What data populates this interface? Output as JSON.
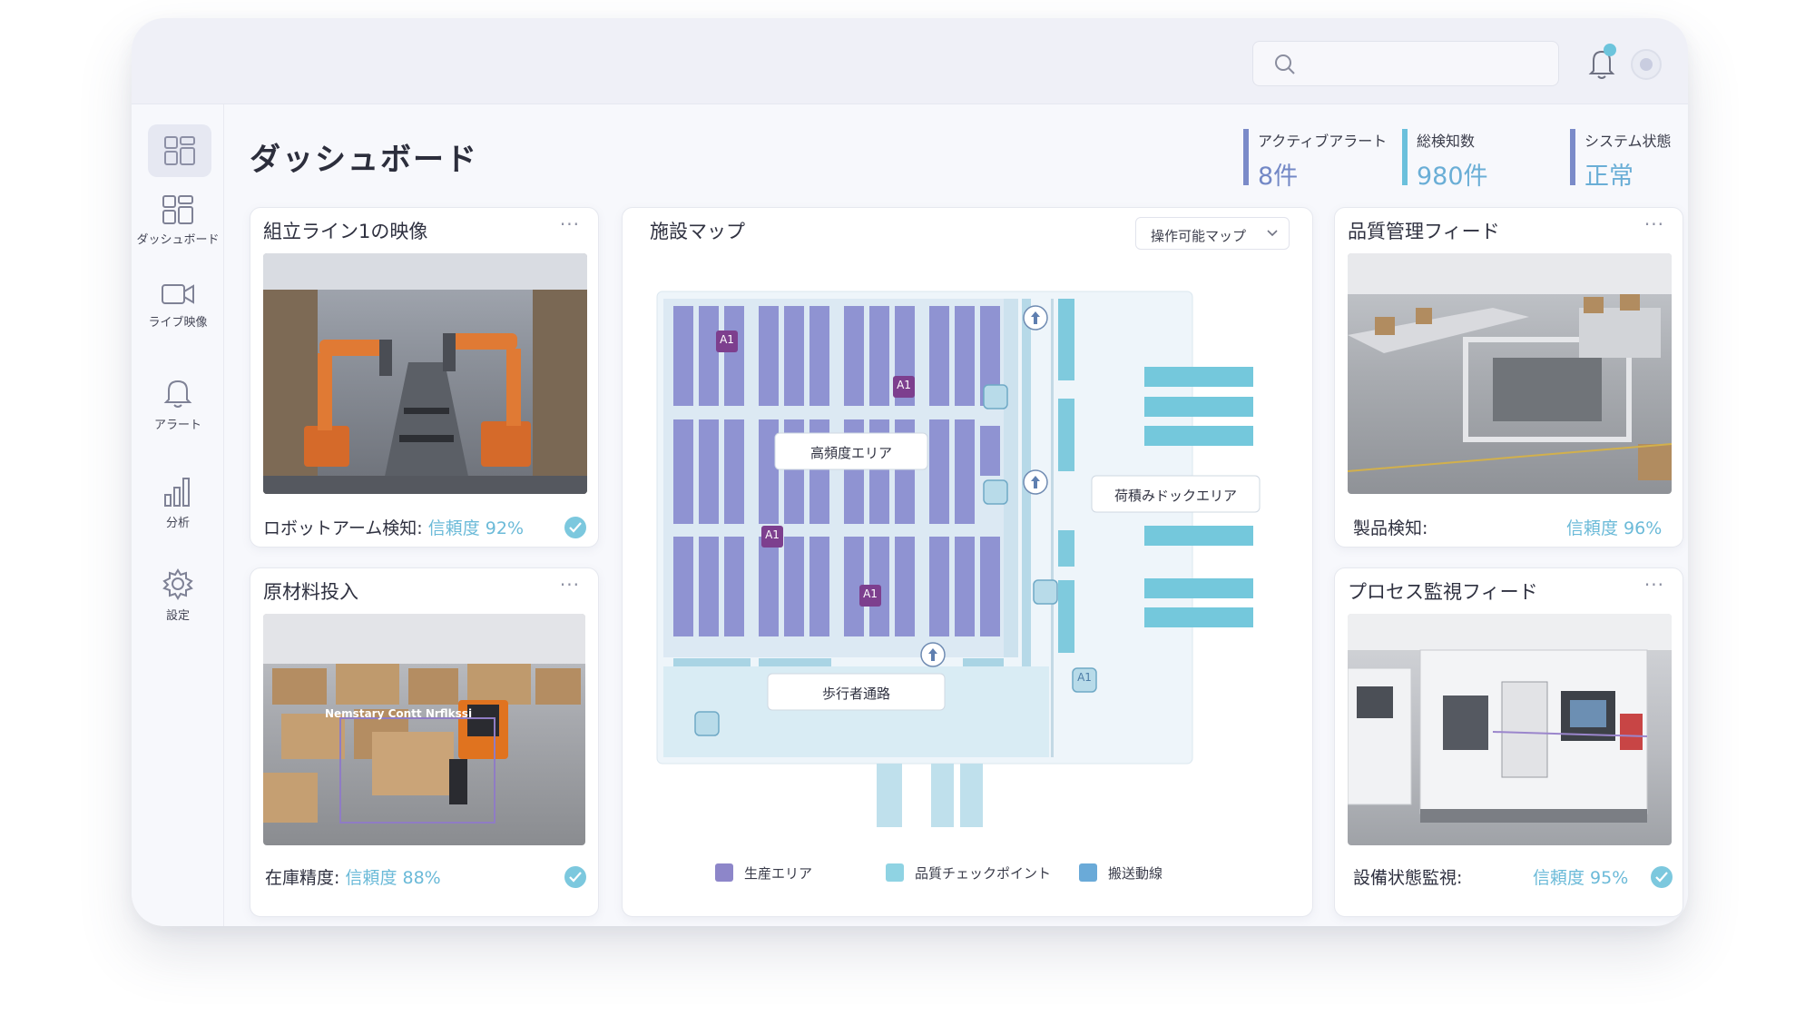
{
  "header": {
    "search_placeholder": ""
  },
  "sidebar": {
    "items": [
      {
        "label": "ダッシュボード",
        "icon": "dashboard-icon"
      },
      {
        "label": "ライブ映像",
        "icon": "video-camera-icon"
      },
      {
        "label": "アラート",
        "icon": "bell-icon"
      },
      {
        "label": "分析",
        "icon": "bar-chart-icon"
      },
      {
        "label": "設定",
        "icon": "gear-icon"
      }
    ]
  },
  "page": {
    "title": "ダッシュボード"
  },
  "stats": [
    {
      "label": "アクティブアラート",
      "value": "8件"
    },
    {
      "label": "総検知数",
      "value": "980件"
    },
    {
      "label": "システム状態",
      "value": "正常"
    }
  ],
  "cards": {
    "assembly": {
      "title": "組立ライン1の映像",
      "menu": "···",
      "foot_label": "ロボットアーム検知:",
      "confidence": "信頼度 92%"
    },
    "material": {
      "title": "原材料投入",
      "menu": "···",
      "foot_label": "在庫精度:",
      "confidence": "信頼度 88%",
      "overlay": "Nemstary Contt Nrflkssi"
    },
    "quality": {
      "title": "品質管理フィード",
      "menu": "···",
      "foot_label": "製品検知:",
      "confidence": "信頼度 96%"
    },
    "process": {
      "title": "プロセス監視フィード",
      "menu": "···",
      "foot_label": "設備状態監視:",
      "confidence": "信頼度 95%"
    }
  },
  "map": {
    "title": "施設マップ",
    "select_value": "操作可能マップ",
    "labels": {
      "high": "高頻度エリア",
      "dock": "荷積みドックエリア",
      "walkway": "歩行者通路"
    },
    "marker": "A1",
    "legend": [
      {
        "label": "生産エリア",
        "color": "#8d86c9"
      },
      {
        "label": "品質チェックポイント",
        "color": "#8fd3e3"
      },
      {
        "label": "搬送動線",
        "color": "#6aaad8"
      }
    ]
  },
  "colors": {
    "accent_blue": "#6bbad8",
    "accent_purple": "#7b8bc9",
    "rack_purple": "#8e93d0",
    "marker_purple": "#7d3f8e"
  }
}
